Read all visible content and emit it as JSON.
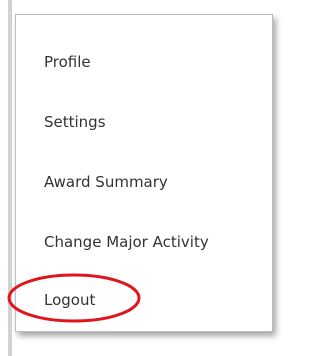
{
  "menu": {
    "items": [
      {
        "label": "Profile"
      },
      {
        "label": "Settings"
      },
      {
        "label": "Award Summary"
      },
      {
        "label": "Change Major Activity"
      },
      {
        "label": "Logout"
      }
    ]
  },
  "highlight": {
    "color": "#e0141c",
    "target": "Logout"
  }
}
